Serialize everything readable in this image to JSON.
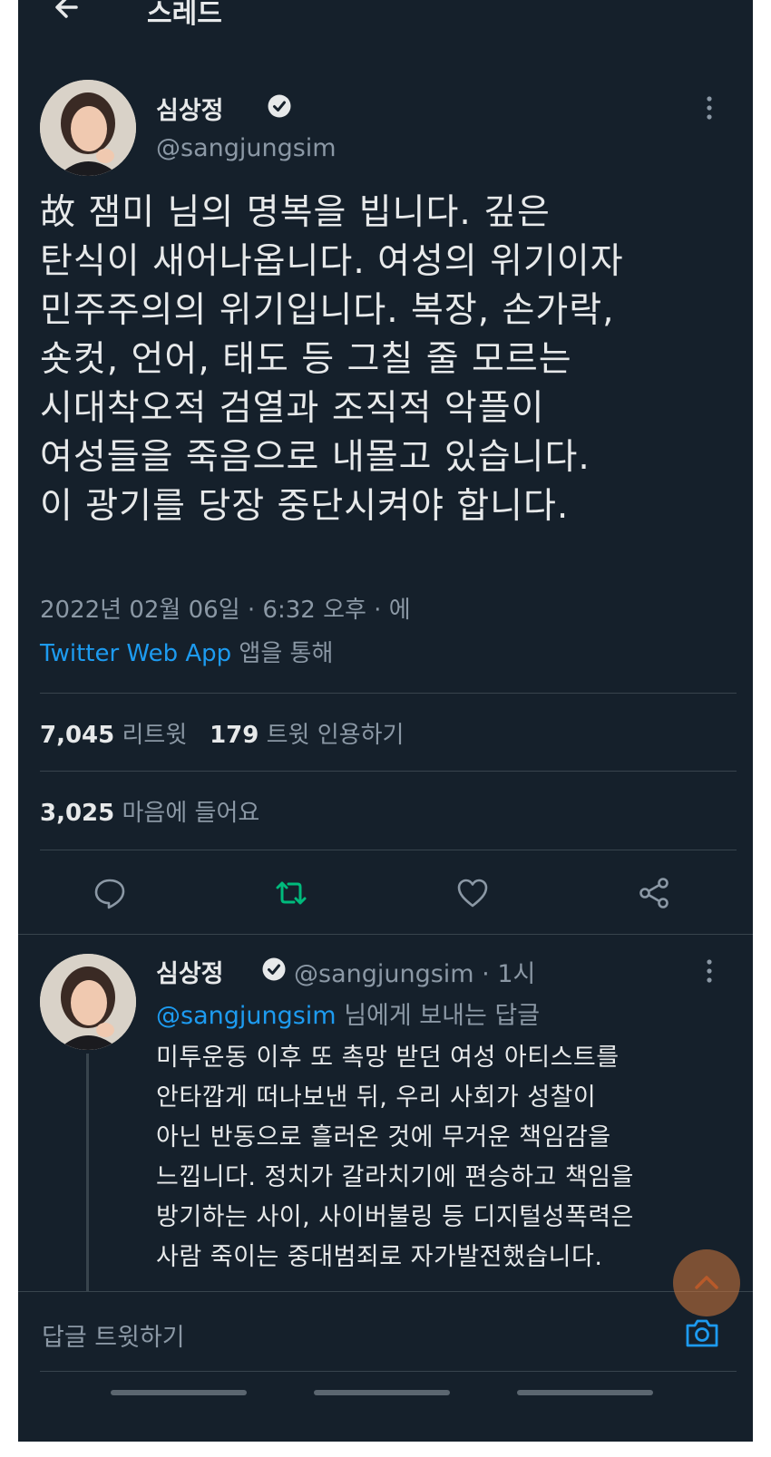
{
  "header": {
    "title": "스레드"
  },
  "tweet": {
    "author_name": "심상정",
    "handle": "@sangjungsim",
    "text_lines": [
      "故 잼미 님의 명복을 빕니다. 깊은",
      "탄식이 새어나옵니다. 여성의 위기이자",
      "민주주의의 위기입니다. 복장, 손가락,",
      "숏컷, 언어, 태도 등 그칠 줄 모르는",
      "시대착오적 검열과 조직적 악플이",
      "여성들을 죽음으로 내몰고 있습니다.",
      "이 광기를 당장 중단시켜야 합니다."
    ],
    "meta": "2022년 02월 06일 · 6:32 오후 · 에",
    "source_app": "Twitter Web App",
    "source_suffix": " 앱을 통해"
  },
  "stats": {
    "retweets_count": "7,045",
    "retweets_label": "리트윗",
    "quotes_count": "179",
    "quotes_label": "트윗 인용하기",
    "likes_count": "3,025",
    "likes_label": "마음에 들어요"
  },
  "reply": {
    "author_name": "심상정",
    "handle_time": "@sangjungsim · 1시",
    "replying_handle": "@sangjungsim",
    "replying_suffix": " 님에게 보내는 답글",
    "text_lines": [
      "미투운동 이후 또 촉망 받던 여성 아티스트를",
      "안타깝게 떠나보낸 뒤, 우리 사회가 성찰이",
      "아닌 반동으로 흘러온 것에 무거운 책임감을",
      "느낍니다. 정치가 갈라치기에 편승하고 책임을",
      "방기하는 사이, 사이버불링 등 디지털성폭력은",
      "사람 죽이는 중대범죄로 자가발전했습니다."
    ]
  },
  "composer": {
    "placeholder": "답글 트윗하기"
  },
  "colors": {
    "background": "#15202b",
    "text": "#e7e9ea",
    "muted": "#8b98a5",
    "link": "#1d9bf0",
    "retweet_active": "#00ba7c",
    "divider": "#38444d"
  },
  "icons": {
    "back": "arrow-left-icon",
    "verified": "verified-badge-icon",
    "more": "more-vertical-icon",
    "reply": "comment-icon",
    "retweet": "retweet-icon",
    "like": "heart-icon",
    "share": "share-icon",
    "camera": "camera-icon",
    "scroll_top": "chevron-up-icon"
  }
}
